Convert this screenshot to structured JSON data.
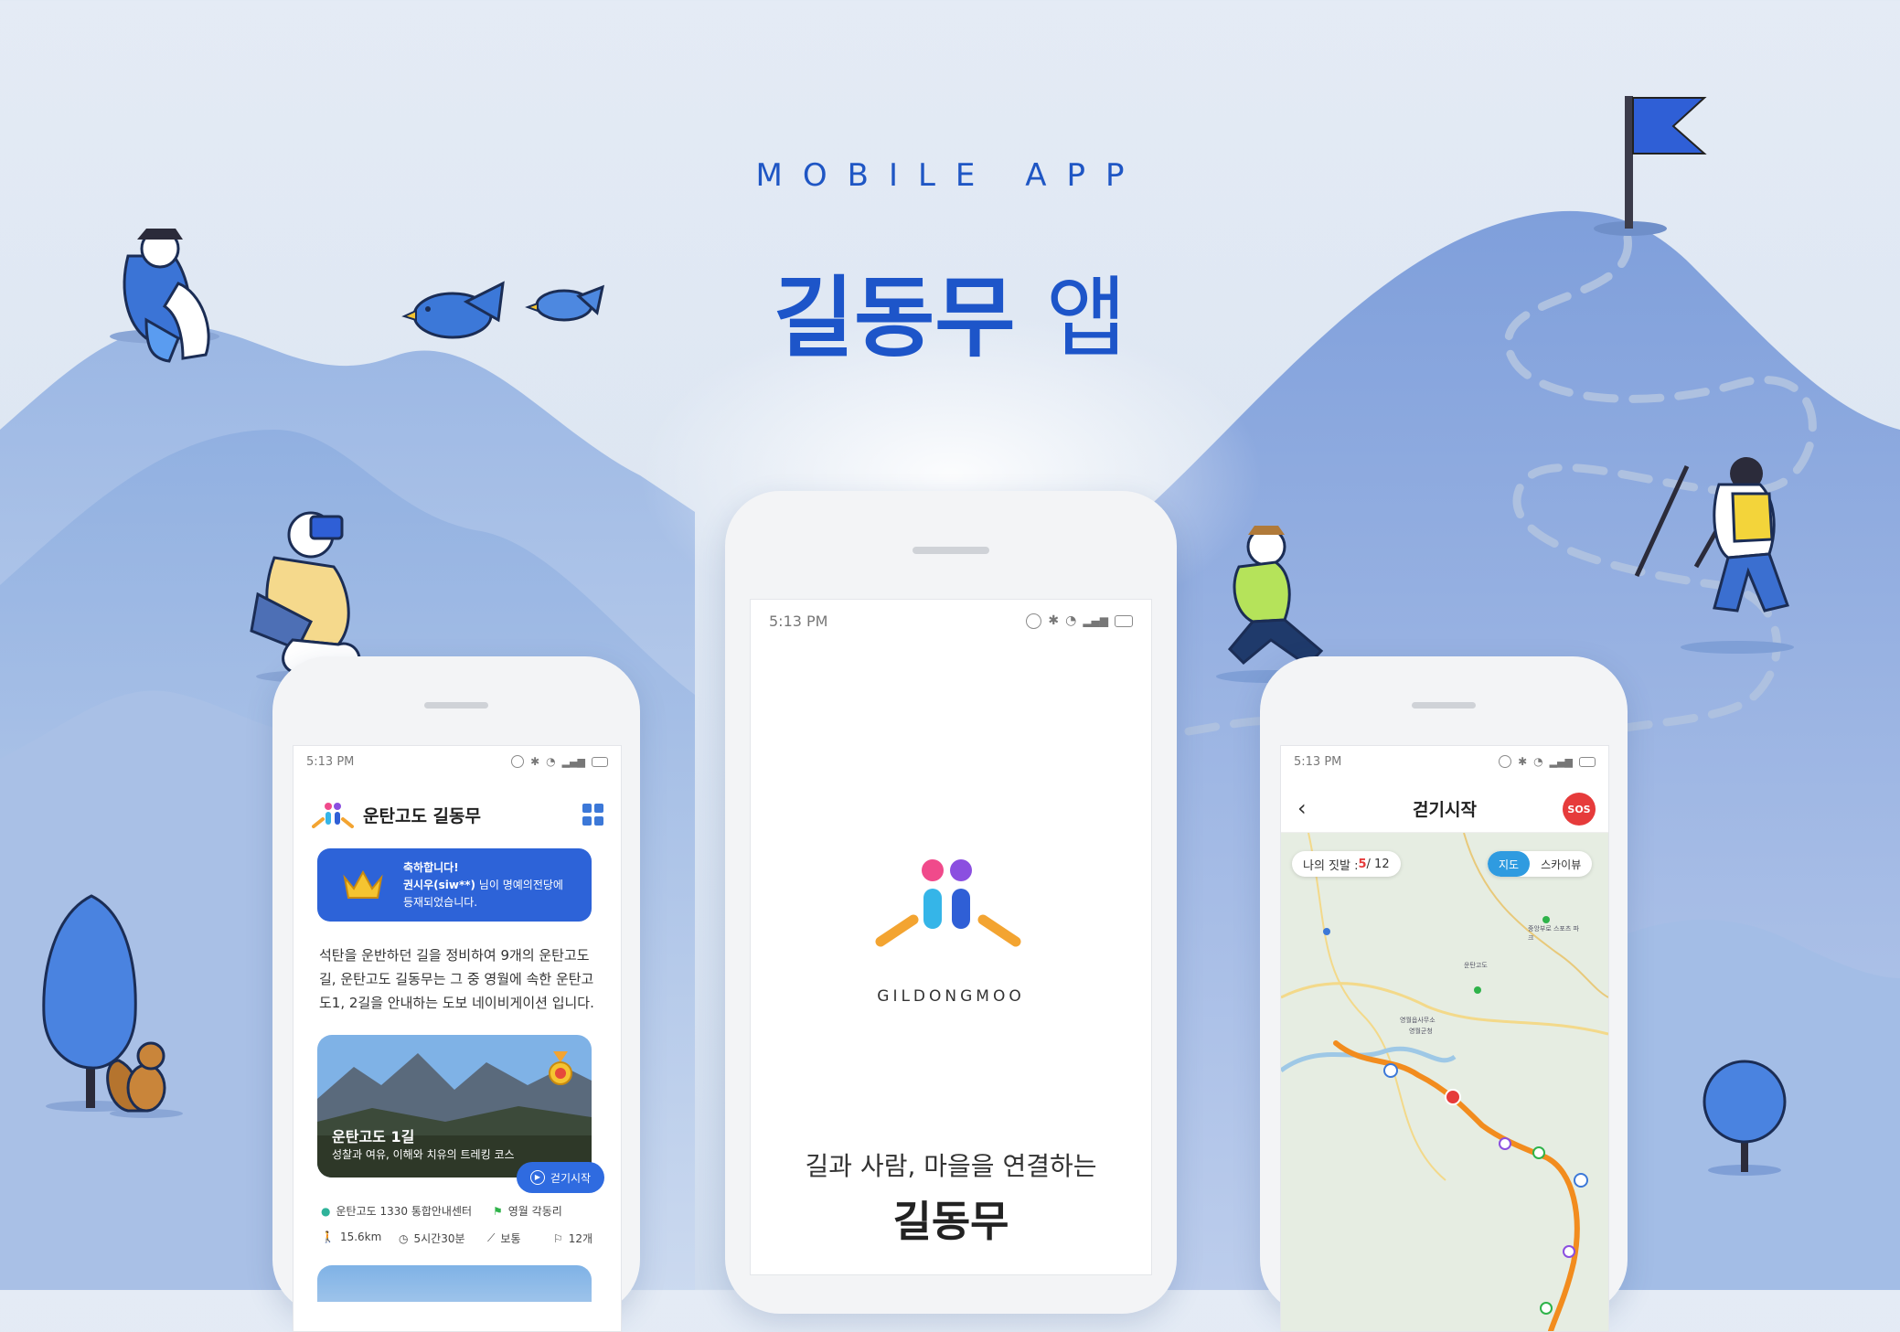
{
  "header": {
    "kicker": "MOBILE APP",
    "title_bold": "길동무",
    "title_light": "앱"
  },
  "colors": {
    "brand_blue": "#1d55c9",
    "accent_orange": "#f3a431",
    "pink": "#f04a8b",
    "purple": "#8b4fe0",
    "sos_red": "#e63b3b",
    "route_orange": "#f28c1e"
  },
  "left_phone": {
    "status_time": "5:13 PM",
    "app_title": "운탄고도 길동무",
    "grid_icon": "grid-icon",
    "banner": {
      "icon": "crown-icon",
      "line1": "축하합니다!",
      "line2_bold": "권시우(siw**)",
      "line2_rest": " 님이 명예의전당에",
      "line3": "등재되었습니다."
    },
    "intro": [
      "석탄을 운반하던 길을 정비하여 9개의 운탄고도",
      "길, 운탄고도 길동무는 그 중 영월에 속한 운탄고",
      "도1, 2길을 안내하는 도보 네이비게이션 입니다."
    ],
    "course": {
      "name": "운탄고도 1길",
      "desc": "성찰과 여유, 이해와 치유의 트레킹 코스",
      "start_button": "걷기시작",
      "start_point": "운탄고도 1330 통합안내센터",
      "end_point": "영월 각동리",
      "distance": "15.6km",
      "duration": "5시간30분",
      "difficulty": "보통",
      "flags": "12개"
    }
  },
  "center_phone": {
    "status_time": "5:13 PM",
    "logo_text": "GILDONGMOO",
    "tagline": "길과 사람, 마을을 연결하는",
    "app_name": "길동무"
  },
  "right_phone": {
    "status_time": "5:13 PM",
    "back_icon": "chevron-left-icon",
    "screen_title": "걷기시작",
    "sos_label": "SOS",
    "footprints_label": "나의 짓발 : ",
    "footprints_current": "5",
    "footprints_total": " / 12",
    "view_map": "지도",
    "view_sky": "스카이뷰",
    "map_labels": [
      "중앙부로 스포츠 파크",
      "운탄고도",
      "영월읍사무소",
      "영월군청"
    ]
  }
}
